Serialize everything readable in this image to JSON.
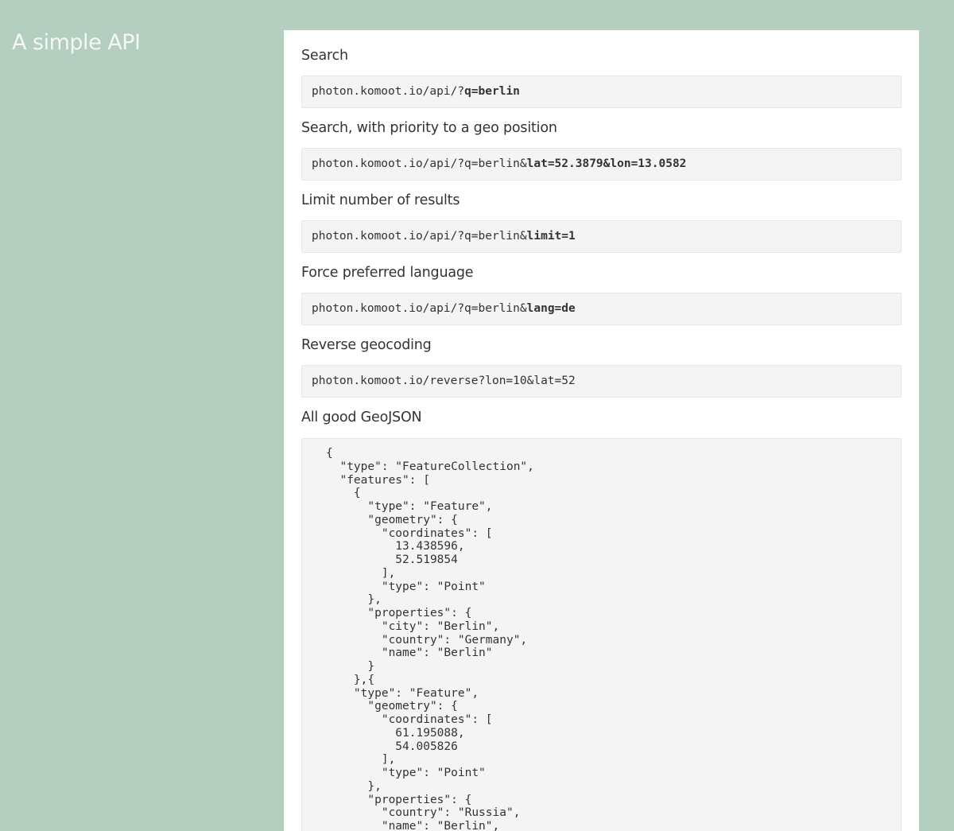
{
  "page": {
    "title": "A simple API"
  },
  "sections": [
    {
      "heading": "Search",
      "url_plain": "photon.komoot.io/api/?",
      "url_bold": "q=berlin"
    },
    {
      "heading": "Search, with priority to a geo position",
      "url_plain": "photon.komoot.io/api/?q=berlin&",
      "url_bold": "lat=52.3879&lon=13.0582"
    },
    {
      "heading": "Limit number of results",
      "url_plain": "photon.komoot.io/api/?q=berlin&",
      "url_bold": "limit=1"
    },
    {
      "heading": "Force preferred language",
      "url_plain": "photon.komoot.io/api/?q=berlin&",
      "url_bold": "lang=de"
    },
    {
      "heading": "Reverse geocoding",
      "url_plain": "photon.komoot.io/reverse?lon=10&lat=52",
      "url_bold": ""
    }
  ],
  "geojson": {
    "heading": "All good GeoJSON",
    "code": "{\n  \"type\": \"FeatureCollection\",\n  \"features\": [\n    {\n      \"type\": \"Feature\",\n      \"geometry\": {\n        \"coordinates\": [\n          13.438596,\n          52.519854\n        ],\n        \"type\": \"Point\"\n      },\n      \"properties\": {\n        \"city\": \"Berlin\",\n        \"country\": \"Germany\",\n        \"name\": \"Berlin\"\n      }\n    },{\n    \"type\": \"Feature\",\n      \"geometry\": {\n        \"coordinates\": [\n          61.195088,\n          54.005826\n        ],\n        \"type\": \"Point\"\n      },\n      \"properties\": {\n        \"country\": \"Russia\",\n        \"name\": \"Berlin\","
  }
}
